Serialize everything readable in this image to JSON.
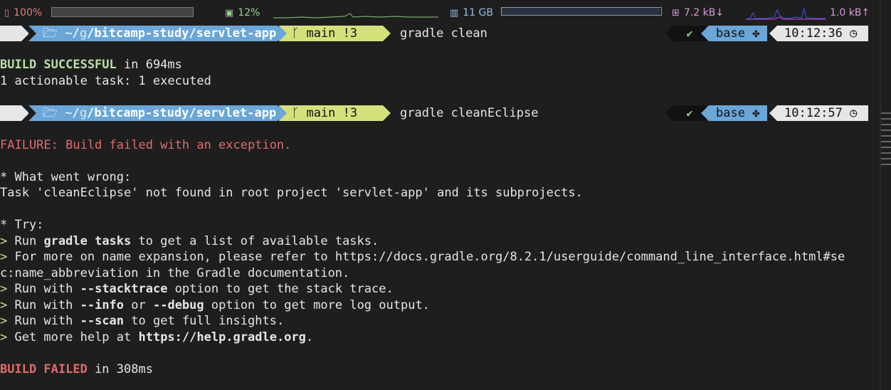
{
  "status_bar": {
    "battery": {
      "icon": "battery-icon",
      "value": "100%",
      "level": 1.0
    },
    "cpu": {
      "icon": "cpu-icon",
      "value": "12%"
    },
    "memory": {
      "icon": "memory-icon",
      "value": "11 GB",
      "level": 0.99
    },
    "network": {
      "icon": "network-icon",
      "down": "7.2 kB↓",
      "up": "1.0 kB↑"
    }
  },
  "prompts": [
    {
      "apple_icon": "",
      "folder_icon": "🗁",
      "path_prefix": "~/",
      "path_dim": "g",
      "path_main": "/bitcamp-study/servlet-app",
      "git_icon": "",
      "branch_icon": "ᚴ",
      "branch": "main !3",
      "command": "gradle clean",
      "status_check": "✔",
      "env": "base",
      "env_icon": "✤",
      "time": "10:12:36",
      "clock_icon": "◷"
    },
    {
      "apple_icon": "",
      "folder_icon": "🗁",
      "path_prefix": "~/",
      "path_dim": "g",
      "path_main": "/bitcamp-study/servlet-app",
      "git_icon": "",
      "branch_icon": "ᚴ",
      "branch": "main !3",
      "command": "gradle cleanEclipse",
      "status_check": "✔",
      "env": "base",
      "env_icon": "✤",
      "time": "10:12:57",
      "clock_icon": "◷"
    }
  ],
  "output1": {
    "success_word": "BUILD SUCCESSFUL",
    "success_rest": " in 694ms",
    "tasks_line": "1 actionable task: 1 executed"
  },
  "output2": {
    "failure_line": "FAILURE: Build failed with an exception.",
    "wrong_header": "* What went wrong:",
    "wrong_detail": "Task 'cleanEclipse' not found in root project 'servlet-app' and its subprojects.",
    "try_header": "* Try:",
    "arrow": "> ",
    "try1_a": "Run ",
    "try1_b": "gradle tasks",
    "try1_c": " to get a list of available tasks.",
    "try2_a": "For more on name expansion, please refer to https://docs.gradle.org/8.2.1/userguide/command_line_interface.html#se",
    "try2_b": "c:name_abbreviation in the Gradle documentation.",
    "try3_a": "Run with ",
    "try3_b": "--stacktrace",
    "try3_c": " option to get the stack trace.",
    "try4_a": "Run with ",
    "try4_b": "--info",
    "try4_c": " or ",
    "try4_d": "--debug",
    "try4_e": " option to get more log output.",
    "try5_a": "Run with ",
    "try5_b": "--scan",
    "try5_c": " to get full insights.",
    "try6_a": "Get more help at ",
    "try6_b": "https://help.gradle.org",
    "try6_c": ".",
    "failed_word": "BUILD FAILED",
    "failed_rest": " in 308ms"
  }
}
